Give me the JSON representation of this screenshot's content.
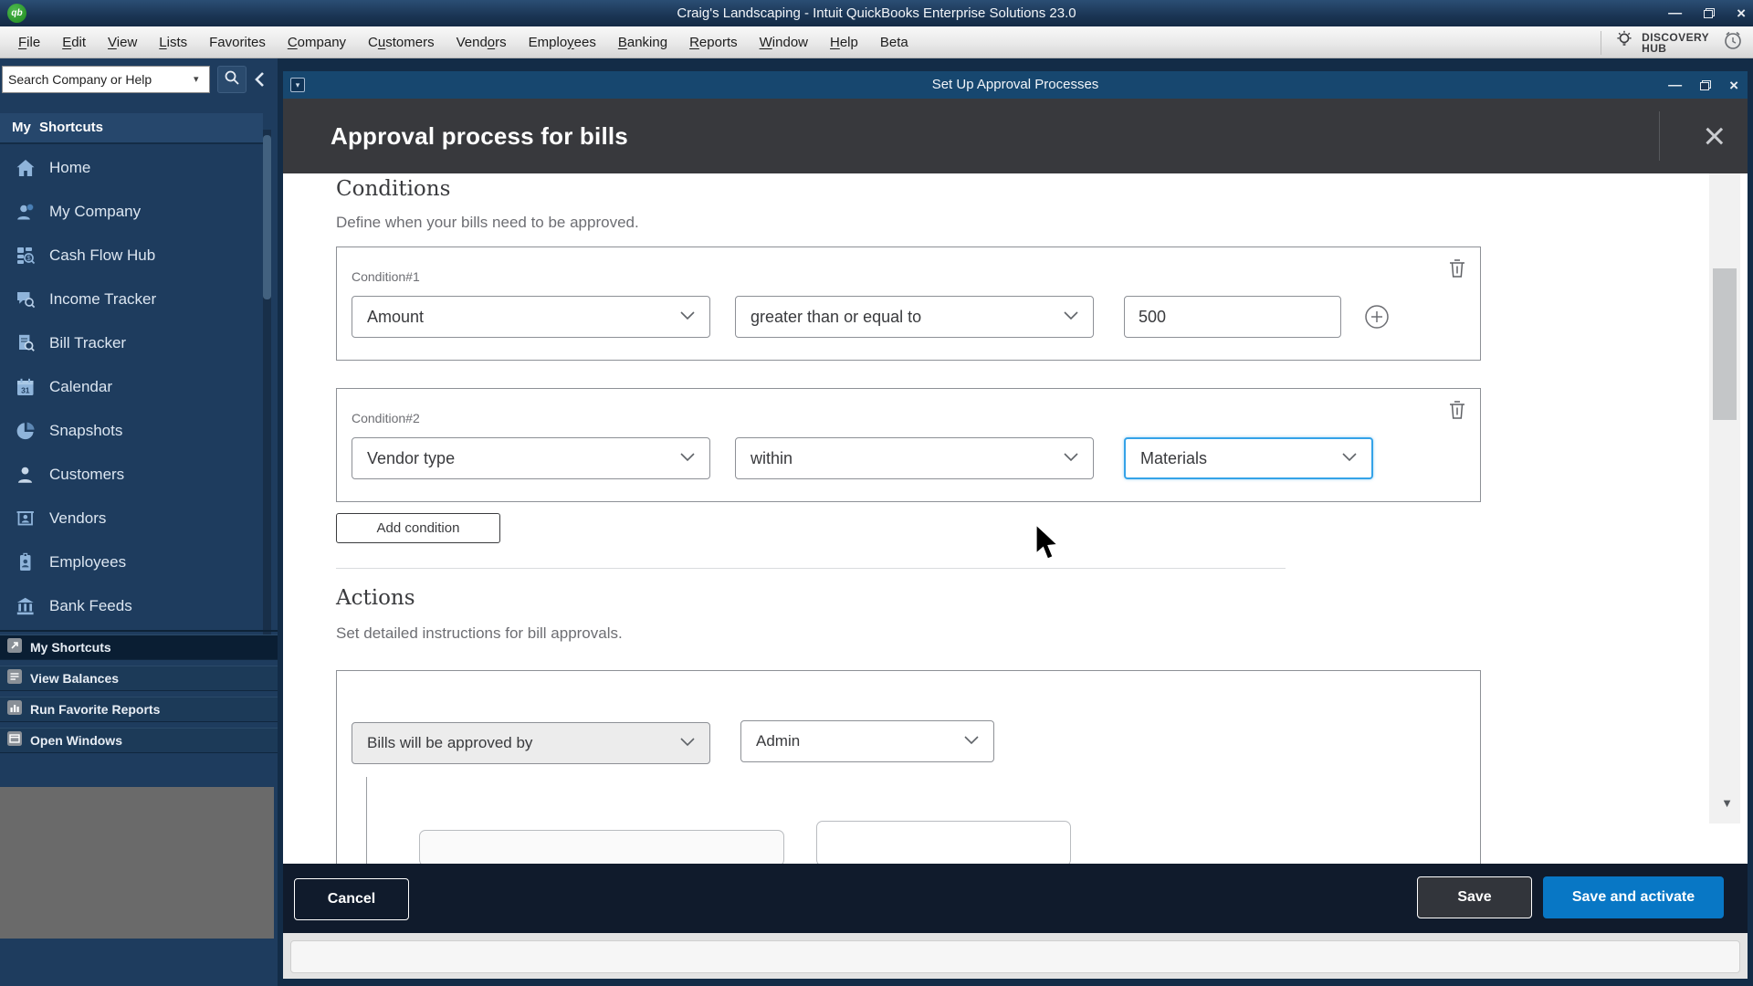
{
  "app": {
    "titlebar": {
      "title": "Craig's Landscaping - Intuit QuickBooks Enterprise Solutions 23.0"
    },
    "menubar": {
      "items": [
        {
          "label": "File",
          "u": 0
        },
        {
          "label": "Edit",
          "u": 0
        },
        {
          "label": "View",
          "u": 0
        },
        {
          "label": "Lists",
          "u": 0
        },
        {
          "label": "Favorites",
          "u": -1
        },
        {
          "label": "Company",
          "u": 0
        },
        {
          "label": "Customers",
          "u": 1
        },
        {
          "label": "Vendors",
          "u": 4
        },
        {
          "label": "Employees",
          "u": 5
        },
        {
          "label": "Banking",
          "u": 0
        },
        {
          "label": "Reports",
          "u": 0
        },
        {
          "label": "Window",
          "u": 0
        },
        {
          "label": "Help",
          "u": 0
        },
        {
          "label": "Beta",
          "u": -1
        }
      ],
      "discovery_hub_line1": "DISCOVERY",
      "discovery_hub_line2": "HUB"
    }
  },
  "sidebar": {
    "search": {
      "text": "Search Company or Help"
    },
    "section_title": "My Shortcuts",
    "items": [
      {
        "label": "Home",
        "icon": "home-icon"
      },
      {
        "label": "My Company",
        "icon": "my-company-icon"
      },
      {
        "label": "Cash Flow Hub",
        "icon": "cash-flow-hub-icon"
      },
      {
        "label": "Income Tracker",
        "icon": "income-tracker-icon"
      },
      {
        "label": "Bill Tracker",
        "icon": "bill-tracker-icon"
      },
      {
        "label": "Calendar",
        "icon": "calendar-icon"
      },
      {
        "label": "Snapshots",
        "icon": "snapshots-icon"
      },
      {
        "label": "Customers",
        "icon": "customers-icon"
      },
      {
        "label": "Vendors",
        "icon": "vendors-icon"
      },
      {
        "label": "Employees",
        "icon": "employees-icon"
      },
      {
        "label": "Bank Feeds",
        "icon": "bank-feeds-icon"
      }
    ],
    "bottom_nav": [
      {
        "label": "My Shortcuts",
        "icon": "shortcut-arrow-icon",
        "active": true
      },
      {
        "label": "View Balances",
        "icon": "balances-icon",
        "active": false
      },
      {
        "label": "Run Favorite Reports",
        "icon": "favorite-reports-icon",
        "active": false
      },
      {
        "label": "Open Windows",
        "icon": "open-windows-icon",
        "active": false
      }
    ]
  },
  "window": {
    "title": "Set Up Approval Processes"
  },
  "dialog": {
    "title": "Approval process for bills",
    "conditions": {
      "heading": "Conditions",
      "description": "Define when your bills need to be approved.",
      "row1": {
        "label": "Condition#1",
        "field": "Amount",
        "operator": "greater than or equal to",
        "value": "500"
      },
      "row2": {
        "label": "Condition#2",
        "field": "Vendor type",
        "operator": "within",
        "value": "Materials"
      },
      "add_button": "Add condition"
    },
    "actions": {
      "heading": "Actions",
      "description": "Set detailed instructions for bill approvals.",
      "approver_field": "Bills will be approved by",
      "approver_value": "Admin"
    },
    "footer": {
      "cancel_button": "Cancel",
      "save_button": "Save",
      "save_activate_button": "Save and activate"
    }
  },
  "colors": {
    "accent_blue": "#0877c5",
    "focus_border": "#35a3e8",
    "titlebar_navy": "#1a3554",
    "window_titlebar": "#17476f",
    "dialog_header": "#38393d",
    "footer_dark": "#101b2c",
    "sidebar_navy": "#1e3c5e",
    "sidebar_icon_blue": "#8fb4da",
    "field_border": "#8d9096"
  }
}
